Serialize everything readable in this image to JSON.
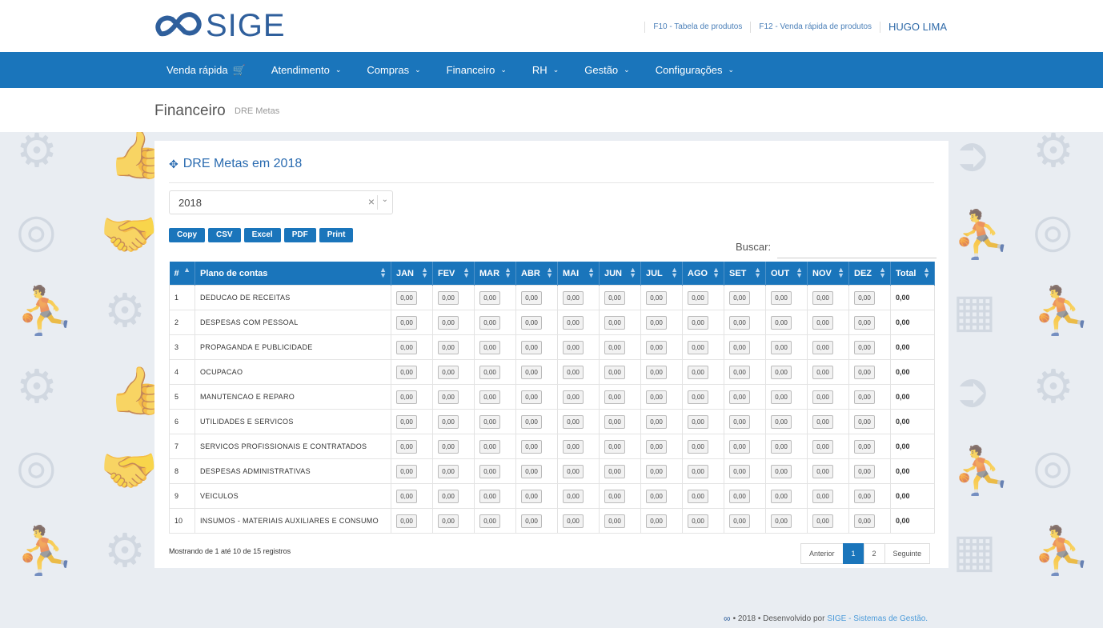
{
  "brand": {
    "name": "SIGE",
    "logo_icon": "infinity-logo-icon"
  },
  "top_links": {
    "link1": "F10 - Tabela de produtos",
    "link2": "F12 - Venda rápida de produtos",
    "user": "HUGO LIMA"
  },
  "nav": [
    {
      "label": "Venda rápida",
      "icon": "cart-icon"
    },
    {
      "label": "Atendimento",
      "icon": "chevron-down-icon"
    },
    {
      "label": "Compras",
      "icon": "chevron-down-icon"
    },
    {
      "label": "Financeiro",
      "icon": "chevron-down-icon"
    },
    {
      "label": "RH",
      "icon": "chevron-down-icon"
    },
    {
      "label": "Gestão",
      "icon": "chevron-down-icon"
    },
    {
      "label": "Configurações",
      "icon": "chevron-down-icon"
    }
  ],
  "breadcrumb": {
    "title": "Financeiro",
    "sub": "DRE Metas"
  },
  "panel": {
    "title": "DRE Metas em 2018",
    "year_select": "2018"
  },
  "export_buttons": [
    "Copy",
    "CSV",
    "Excel",
    "PDF",
    "Print"
  ],
  "search": {
    "label": "Buscar:",
    "value": ""
  },
  "table": {
    "headers": [
      "#",
      "Plano de contas",
      "JAN",
      "FEV",
      "MAR",
      "ABR",
      "MAI",
      "JUN",
      "JUL",
      "AGO",
      "SET",
      "OUT",
      "NOV",
      "DEZ",
      "Total"
    ],
    "rows": [
      {
        "n": "1",
        "plano": "DEDUCAO DE RECEITAS",
        "months": [
          "0,00",
          "0,00",
          "0,00",
          "0,00",
          "0,00",
          "0,00",
          "0,00",
          "0,00",
          "0,00",
          "0,00",
          "0,00",
          "0,00"
        ],
        "total": "0,00"
      },
      {
        "n": "2",
        "plano": "DESPESAS COM PESSOAL",
        "months": [
          "0,00",
          "0,00",
          "0,00",
          "0,00",
          "0,00",
          "0,00",
          "0,00",
          "0,00",
          "0,00",
          "0,00",
          "0,00",
          "0,00"
        ],
        "total": "0,00"
      },
      {
        "n": "3",
        "plano": "PROPAGANDA E PUBLICIDADE",
        "months": [
          "0,00",
          "0,00",
          "0,00",
          "0,00",
          "0,00",
          "0,00",
          "0,00",
          "0,00",
          "0,00",
          "0,00",
          "0,00",
          "0,00"
        ],
        "total": "0,00"
      },
      {
        "n": "4",
        "plano": "OCUPACAO",
        "months": [
          "0,00",
          "0,00",
          "0,00",
          "0,00",
          "0,00",
          "0,00",
          "0,00",
          "0,00",
          "0,00",
          "0,00",
          "0,00",
          "0,00"
        ],
        "total": "0,00"
      },
      {
        "n": "5",
        "plano": "MANUTENCAO E REPARO",
        "months": [
          "0,00",
          "0,00",
          "0,00",
          "0,00",
          "0,00",
          "0,00",
          "0,00",
          "0,00",
          "0,00",
          "0,00",
          "0,00",
          "0,00"
        ],
        "total": "0,00"
      },
      {
        "n": "6",
        "plano": "UTILIDADES E SERVICOS",
        "months": [
          "0,00",
          "0,00",
          "0,00",
          "0,00",
          "0,00",
          "0,00",
          "0,00",
          "0,00",
          "0,00",
          "0,00",
          "0,00",
          "0,00"
        ],
        "total": "0,00"
      },
      {
        "n": "7",
        "plano": "SERVICOS PROFISSIONAIS E CONTRATADOS",
        "months": [
          "0,00",
          "0,00",
          "0,00",
          "0,00",
          "0,00",
          "0,00",
          "0,00",
          "0,00",
          "0,00",
          "0,00",
          "0,00",
          "0,00"
        ],
        "total": "0,00"
      },
      {
        "n": "8",
        "plano": "DESPESAS ADMINISTRATIVAS",
        "months": [
          "0,00",
          "0,00",
          "0,00",
          "0,00",
          "0,00",
          "0,00",
          "0,00",
          "0,00",
          "0,00",
          "0,00",
          "0,00",
          "0,00"
        ],
        "total": "0,00"
      },
      {
        "n": "9",
        "plano": "VEICULOS",
        "months": [
          "0,00",
          "0,00",
          "0,00",
          "0,00",
          "0,00",
          "0,00",
          "0,00",
          "0,00",
          "0,00",
          "0,00",
          "0,00",
          "0,00"
        ],
        "total": "0,00"
      },
      {
        "n": "10",
        "plano": "INSUMOS - MATERIAIS AUXILIARES E CONSUMO",
        "months": [
          "0,00",
          "0,00",
          "0,00",
          "0,00",
          "0,00",
          "0,00",
          "0,00",
          "0,00",
          "0,00",
          "0,00",
          "0,00",
          "0,00"
        ],
        "total": "0,00"
      }
    ]
  },
  "info": "Mostrando de 1 até 10 de 15 registros",
  "pagination": {
    "prev": "Anterior",
    "pages": [
      "1",
      "2"
    ],
    "active": "1",
    "next": "Seguinte"
  },
  "footer": {
    "text": "• 2018 • Desenvolvido por",
    "link": "SIGE - Sistemas de Gestão."
  },
  "colors": {
    "primary": "#1a75bb",
    "background": "#e9edf2",
    "accent_text": "#2a6bb0"
  }
}
